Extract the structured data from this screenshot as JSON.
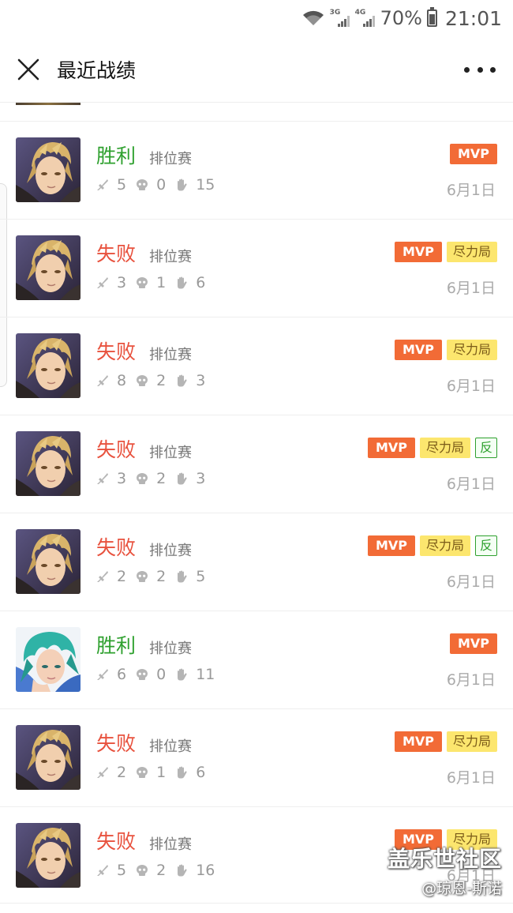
{
  "status_bar": {
    "net1": "3G",
    "net2": "4G",
    "battery": "70%",
    "battery_level": 0.7,
    "time": "21:01"
  },
  "header": {
    "title": "最近战绩",
    "close_icon": "close-icon",
    "more_icon": "more-icon"
  },
  "colors": {
    "win": "#2ea02e",
    "lose": "#e8523e",
    "mvp": "#f26b36",
    "effort": "#fce66e"
  },
  "badge_labels": {
    "mvp": "MVP",
    "effort": "尽力局",
    "anti": "反"
  },
  "records": [
    {
      "result": "胜利",
      "outcome": "win",
      "mode": "排位赛",
      "kills": "5",
      "deaths": "0",
      "assists": "15",
      "date": "6月1日",
      "hero": "blond",
      "badges": [
        "mvp"
      ]
    },
    {
      "result": "失败",
      "outcome": "lose",
      "mode": "排位赛",
      "kills": "3",
      "deaths": "1",
      "assists": "6",
      "date": "6月1日",
      "hero": "blond",
      "badges": [
        "mvp",
        "effort"
      ]
    },
    {
      "result": "失败",
      "outcome": "lose",
      "mode": "排位赛",
      "kills": "8",
      "deaths": "2",
      "assists": "3",
      "date": "6月1日",
      "hero": "blond",
      "badges": [
        "mvp",
        "effort"
      ]
    },
    {
      "result": "失败",
      "outcome": "lose",
      "mode": "排位赛",
      "kills": "3",
      "deaths": "2",
      "assists": "3",
      "date": "6月1日",
      "hero": "blond",
      "badges": [
        "mvp",
        "effort",
        "anti"
      ]
    },
    {
      "result": "失败",
      "outcome": "lose",
      "mode": "排位赛",
      "kills": "2",
      "deaths": "2",
      "assists": "5",
      "date": "6月1日",
      "hero": "blond",
      "badges": [
        "mvp",
        "effort",
        "anti"
      ]
    },
    {
      "result": "胜利",
      "outcome": "win",
      "mode": "排位赛",
      "kills": "6",
      "deaths": "0",
      "assists": "11",
      "date": "6月1日",
      "hero": "teal",
      "badges": [
        "mvp"
      ]
    },
    {
      "result": "失败",
      "outcome": "lose",
      "mode": "排位赛",
      "kills": "2",
      "deaths": "1",
      "assists": "6",
      "date": "6月1日",
      "hero": "blond",
      "badges": [
        "mvp",
        "effort"
      ]
    },
    {
      "result": "失败",
      "outcome": "lose",
      "mode": "排位赛",
      "kills": "5",
      "deaths": "2",
      "assists": "16",
      "date": "6月1日",
      "hero": "blond",
      "badges": [
        "mvp",
        "effort"
      ]
    }
  ],
  "watermark": {
    "line1": "盖乐世社区",
    "line2": "@琼恩-斯诺"
  }
}
